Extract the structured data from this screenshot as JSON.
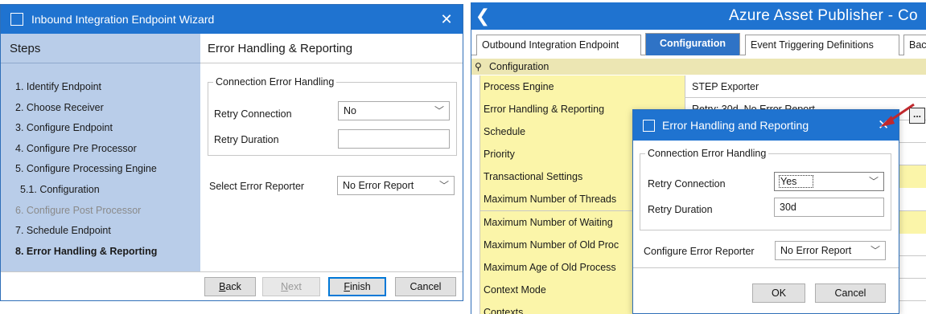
{
  "wizard": {
    "title": "Inbound Integration Endpoint Wizard",
    "close": "✕",
    "steps_heading": "Steps",
    "steps": [
      {
        "label": "1. Identify Endpoint",
        "state": "normal"
      },
      {
        "label": "2. Choose Receiver",
        "state": "normal"
      },
      {
        "label": "3. Configure Endpoint",
        "state": "normal"
      },
      {
        "label": "4. Configure Pre Processor",
        "state": "normal"
      },
      {
        "label": "5. Configure Processing Engine",
        "state": "normal"
      },
      {
        "label": "5.1. Configuration",
        "state": "sub"
      },
      {
        "label": "6. Configure Post Processor",
        "state": "disabled"
      },
      {
        "label": "7. Schedule Endpoint",
        "state": "normal"
      },
      {
        "label": "8. Error Handling & Reporting",
        "state": "active"
      }
    ],
    "content_title": "Error Handling & Reporting",
    "group_label": "Connection Error Handling",
    "retry_connection_label": "Retry Connection",
    "retry_connection_value": "No",
    "retry_duration_label": "Retry Duration",
    "retry_duration_value": "",
    "error_reporter_label": "Select Error Reporter",
    "error_reporter_value": "No Error Report",
    "buttons": {
      "back_u": "B",
      "back_rest": "ack",
      "next_u": "N",
      "next_rest": "ext",
      "finish_u": "F",
      "finish_rest": "inish",
      "cancel": "Cancel"
    }
  },
  "publisher": {
    "back_icon": "❮",
    "title": "Azure Asset Publisher - Co",
    "tabs": [
      {
        "label": "Outbound Integration Endpoint",
        "active": false
      },
      {
        "label": "Configuration",
        "active": true
      },
      {
        "label": "Event Triggering Definitions",
        "active": false
      },
      {
        "label": "Bac",
        "active": false
      }
    ],
    "tree_root": "Configuration",
    "rows": [
      {
        "name": "Process Engine",
        "value": "STEP Exporter"
      },
      {
        "name": "Error Handling & Reporting",
        "value": "Retry: 30d, No Error Report"
      },
      {
        "name": "Schedule",
        "value": ""
      },
      {
        "name": "Priority",
        "value": ""
      },
      {
        "name": "Transactional Settings",
        "value": ""
      },
      {
        "name": "Maximum Number of Threads",
        "value": ""
      },
      {
        "name": "Maximum Number of Waiting",
        "value": ""
      },
      {
        "name": "Maximum Number of Old Proc",
        "value": ""
      },
      {
        "name": "Maximum Age of Old Process",
        "value": ""
      },
      {
        "name": "Context Mode",
        "value": ""
      },
      {
        "name": "Contexts",
        "value": ""
      }
    ],
    "ellipsis": "..."
  },
  "dialog": {
    "title": "Error Handling and Reporting",
    "close": "✕",
    "group_label": "Connection Error Handling",
    "retry_connection_label": "Retry Connection",
    "retry_connection_value": "Yes",
    "retry_duration_label": "Retry Duration",
    "retry_duration_value": "30d",
    "error_reporter_label": "Configure Error Reporter",
    "error_reporter_value": "No Error Report",
    "ok": "OK",
    "cancel": "Cancel"
  },
  "colors": {
    "titlebar": "#1f73d0",
    "steps_panel": "#b9cde9",
    "property_yellow": "#fbf5a9",
    "active_tab": "#2f73c6",
    "annotation_arrow": "#c0282d"
  }
}
